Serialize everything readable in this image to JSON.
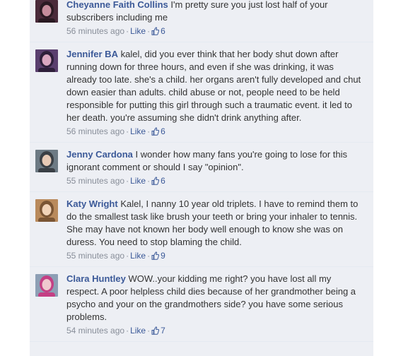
{
  "comments": [
    {
      "author": "Cheyanne Faith Collins",
      "text": "I'm pretty sure you just lost half of your subscribers including me",
      "time": "56 minutes ago",
      "like_label": "Like",
      "like_count": "6",
      "avatar_colors": [
        "#4a2b3a",
        "#c58c9b",
        "#2a1a22"
      ]
    },
    {
      "author": "Jennifer BA",
      "text": "kalel, did you ever think that her body shut down after running down for three hours, and even if she was drinking, it was already too late. she's a child. her organs aren't fully developed and chut down easier than adults. child abuse or not, people need to be held responsible for putting this girl through such a traumatic event. it led to her death. you're assuming she didn't drink anything after.",
      "time": "56 minutes ago",
      "like_label": "Like",
      "like_count": "6",
      "avatar_colors": [
        "#5a3f6e",
        "#d9a6c0",
        "#2e1f3a"
      ]
    },
    {
      "author": "Jenny Cardona",
      "text": "I wonder how many fans you're going to lose for this ignorant comment or should I say \"opinion\".",
      "time": "55 minutes ago",
      "like_label": "Like",
      "like_count": "6",
      "avatar_colors": [
        "#6d7a84",
        "#e7c9b5",
        "#3a3f45"
      ]
    },
    {
      "author": "Katy Wright",
      "text": "Kalel, I nanny 10 year old triplets. I have to remind them to do the smallest task like brush your teeth or bring your inhaler to tennis. She may have not known her body well enough to know she was on duress. You need to stop blaming the child.",
      "time": "55 minutes ago",
      "like_label": "Like",
      "like_count": "9",
      "avatar_colors": [
        "#b98a5c",
        "#f1d3b8",
        "#7a5534"
      ]
    },
    {
      "author": "Clara Huntley",
      "text": "WOW..your kidding me right? you have lost all my respect. A poor helpless child dies because of her grandmother being a psycho and your on the grandmothers side? you have some serious problems.",
      "time": "54 minutes ago",
      "like_label": "Like",
      "like_count": "7",
      "avatar_colors": [
        "#8d9fb5",
        "#f0c8cf",
        "#c43f84"
      ]
    }
  ]
}
